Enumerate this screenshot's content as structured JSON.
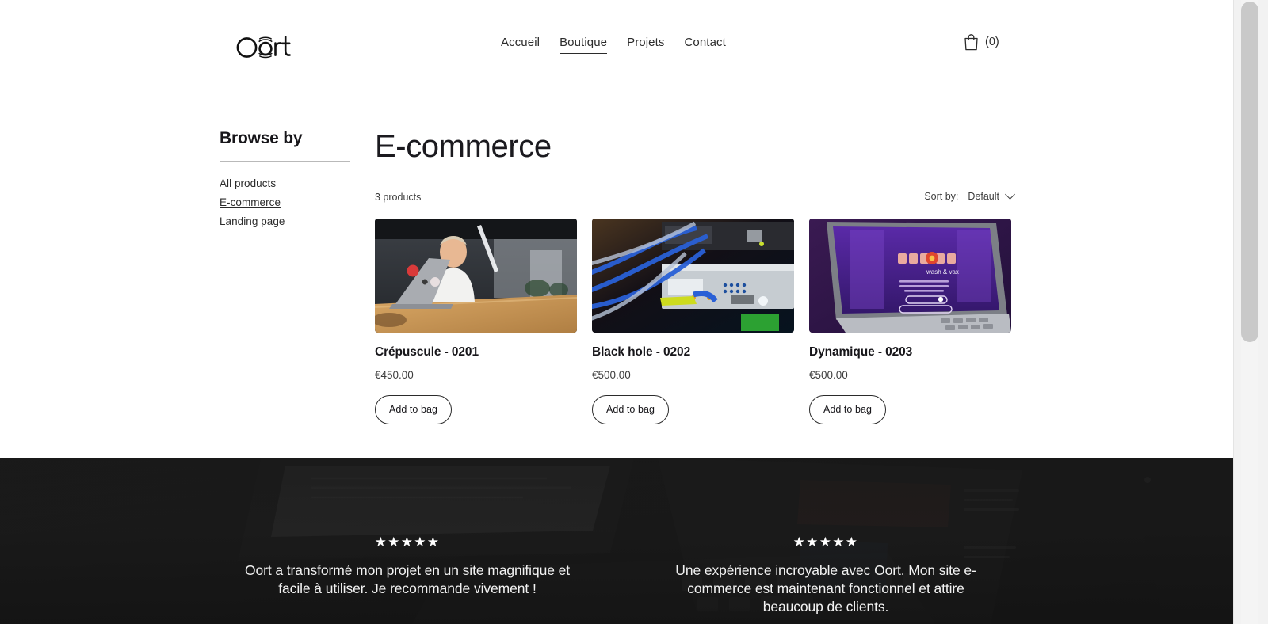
{
  "header": {
    "logo_alt": "Oort",
    "nav": [
      {
        "label": "Accueil",
        "active": false
      },
      {
        "label": "Boutique",
        "active": true
      },
      {
        "label": "Projets",
        "active": false
      },
      {
        "label": "Contact",
        "active": false
      }
    ],
    "cart": {
      "icon": "shopping-bag-icon",
      "count_label": "(0)"
    }
  },
  "sidebar": {
    "title": "Browse by",
    "items": [
      {
        "label": "All products",
        "active": false
      },
      {
        "label": "E-commerce",
        "active": true
      },
      {
        "label": "Landing page",
        "active": false
      }
    ]
  },
  "main": {
    "title": "E-commerce",
    "product_count": "3 products",
    "sort": {
      "label": "Sort by:",
      "value": "Default",
      "options": [
        "Default"
      ],
      "icon": "chevron-down-icon"
    },
    "products": [
      {
        "name": "Crépuscule - 0201",
        "price": "€450.00",
        "button": "Add to bag",
        "image_alt": "man-working-on-laptop-at-wooden-desk"
      },
      {
        "name": "Black hole - 0202",
        "price": "€500.00",
        "button": "Add to bag",
        "image_alt": "cloud-router-switch-with-blue-network-cables"
      },
      {
        "name": "Dynamique - 0203",
        "price": "€500.00",
        "button": "Add to bag",
        "image_alt": "laptop-showing-purple-website-on-purple-background"
      }
    ]
  },
  "testimonials": [
    {
      "stars": "★★★★★",
      "text": "Oort a transformé mon projet en un site magnifique et facile à utiliser. Je recommande vivement !"
    },
    {
      "stars": "★★★★★",
      "text": "Une expérience incroyable avec Oort. Mon site e-commerce est maintenant fonctionnel et attire beaucoup de clients."
    }
  ],
  "colors": {
    "text": "#2b2b2b",
    "heading": "#17161a",
    "muted": "#3c3c3c",
    "page_bg": "#ffffff",
    "dark_band": "#181818"
  }
}
